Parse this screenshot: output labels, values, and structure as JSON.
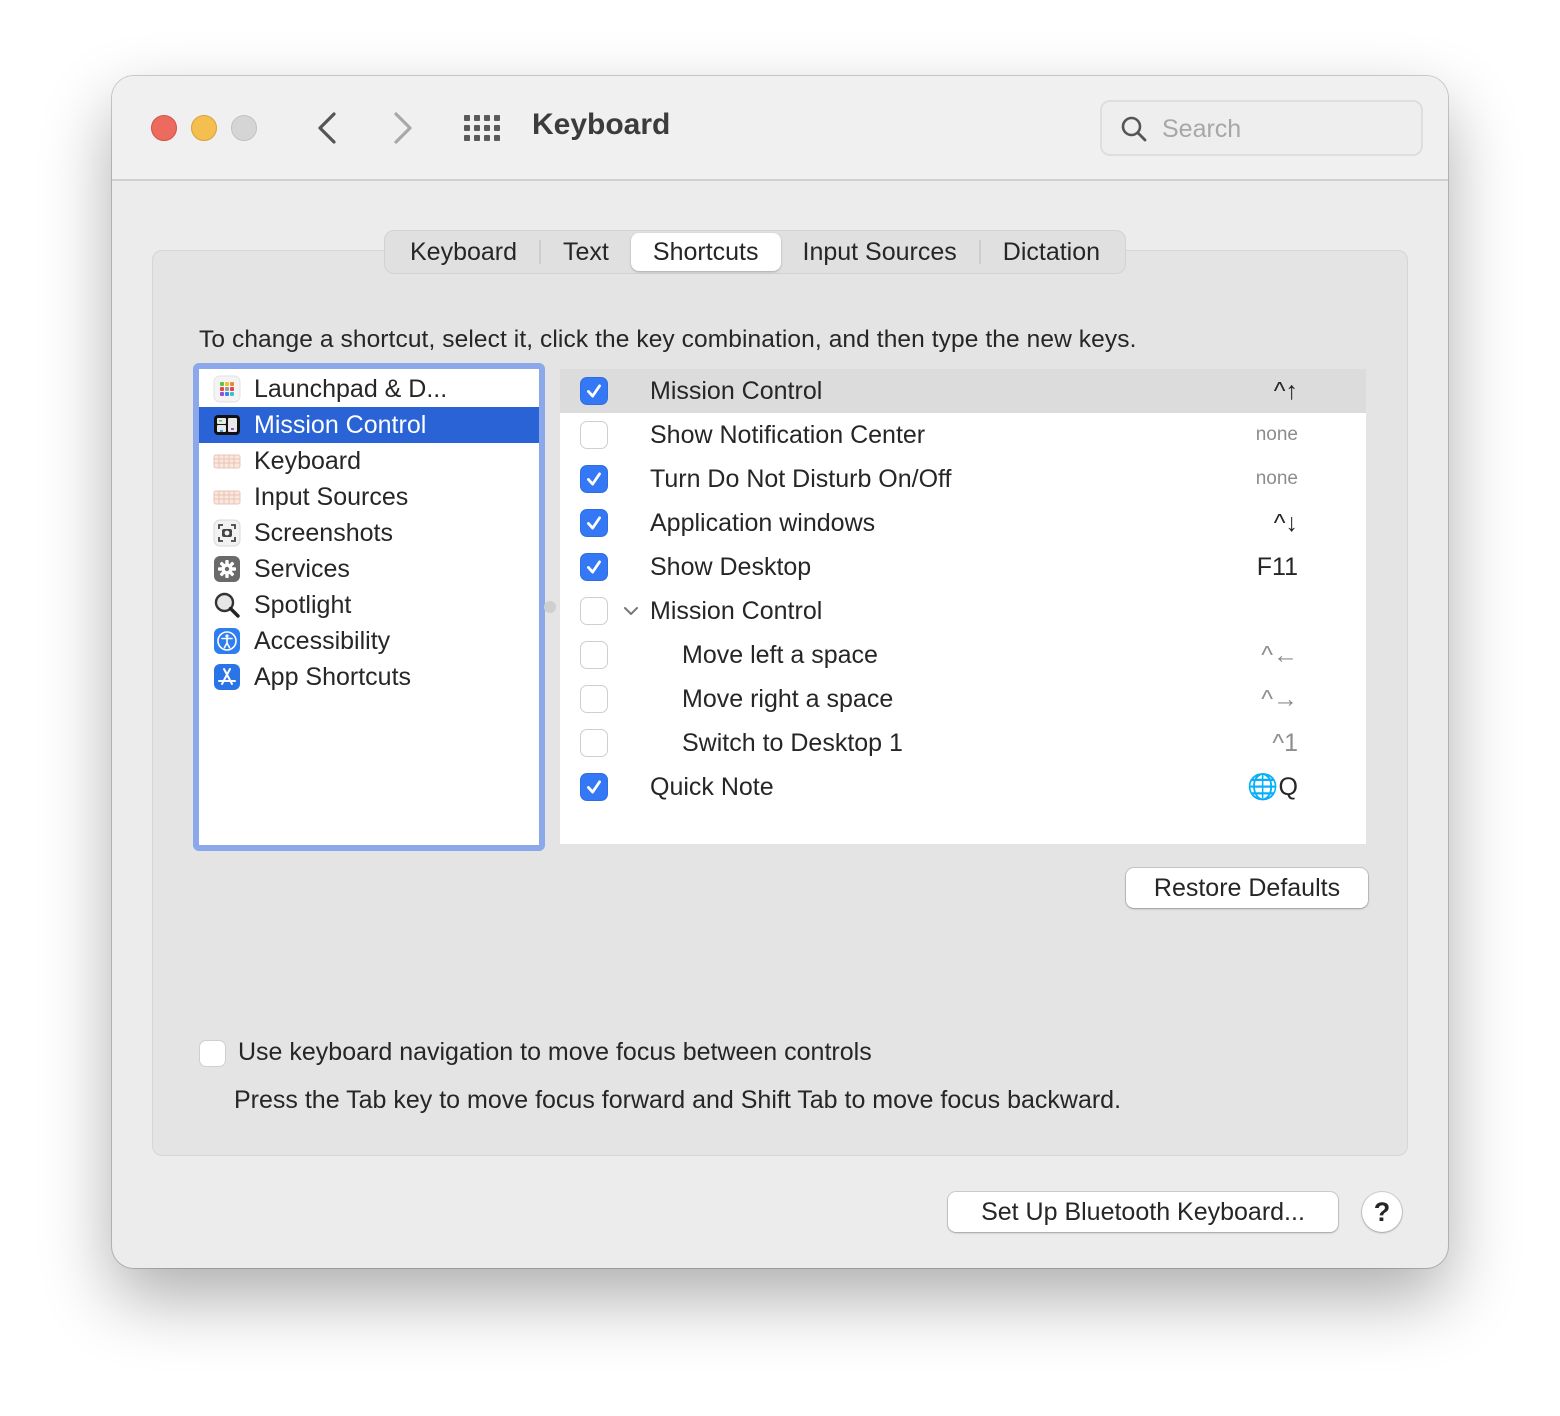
{
  "window": {
    "title": "Keyboard",
    "traffic_lights": {
      "close": "#ec6a5e",
      "minimize": "#f5bf4f",
      "zoom": "#d5d5d5"
    }
  },
  "toolbar": {
    "back_icon": "chevron-left-icon",
    "forward_icon": "chevron-right-icon",
    "show_all_icon": "grid-icon",
    "search": {
      "placeholder": "Search",
      "value": "",
      "icon": "magnifier-icon"
    }
  },
  "tabs": [
    {
      "label": "Keyboard",
      "active": false
    },
    {
      "label": "Text",
      "active": false
    },
    {
      "label": "Shortcuts",
      "active": true
    },
    {
      "label": "Input Sources",
      "active": false
    },
    {
      "label": "Dictation",
      "active": false
    }
  ],
  "instructions": "To change a shortcut, select it, click the key combination, and then type the new keys.",
  "categories": [
    {
      "label": "Launchpad & D...",
      "icon": "launchpad-icon",
      "selected": false
    },
    {
      "label": "Mission Control",
      "icon": "mission-control-icon",
      "selected": true
    },
    {
      "label": "Keyboard",
      "icon": "keyboard-icon",
      "selected": false
    },
    {
      "label": "Input Sources",
      "icon": "keyboard-icon",
      "selected": false
    },
    {
      "label": "Screenshots",
      "icon": "screenshot-icon",
      "selected": false
    },
    {
      "label": "Services",
      "icon": "gear-icon",
      "selected": false
    },
    {
      "label": "Spotlight",
      "icon": "magnifying-glass-icon",
      "selected": false
    },
    {
      "label": "Accessibility",
      "icon": "accessibility-icon",
      "selected": false
    },
    {
      "label": "App Shortcuts",
      "icon": "app-store-icon",
      "selected": false
    }
  ],
  "shortcuts": [
    {
      "label": "Mission Control",
      "checked": true,
      "key": "^↑",
      "selected": true,
      "indent": false,
      "style": "normal"
    },
    {
      "label": "Show Notification Center",
      "checked": false,
      "key": "none",
      "selected": false,
      "indent": false,
      "style": "muted"
    },
    {
      "label": "Turn Do Not Disturb On/Off",
      "checked": true,
      "key": "none",
      "selected": false,
      "indent": false,
      "style": "muted"
    },
    {
      "label": "Application windows",
      "checked": true,
      "key": "^↓",
      "selected": false,
      "indent": false,
      "style": "normal"
    },
    {
      "label": "Show Desktop",
      "checked": true,
      "key": "F11",
      "selected": false,
      "indent": false,
      "style": "normal"
    },
    {
      "label": "Mission Control",
      "checked": false,
      "key": "",
      "selected": false,
      "indent": false,
      "style": "normal",
      "expandable": true,
      "expanded": true
    },
    {
      "label": "Move left a space",
      "checked": false,
      "key": "^←",
      "selected": false,
      "indent": true,
      "style": "dim"
    },
    {
      "label": "Move right a space",
      "checked": false,
      "key": "^→",
      "selected": false,
      "indent": true,
      "style": "dim"
    },
    {
      "label": "Switch to Desktop 1",
      "checked": false,
      "key": "^1",
      "selected": false,
      "indent": true,
      "style": "dim"
    },
    {
      "label": "Quick Note",
      "checked": true,
      "key": "🌐Q",
      "selected": false,
      "indent": false,
      "style": "normal"
    }
  ],
  "buttons": {
    "restore_defaults": "Restore Defaults",
    "bluetooth_keyboard": "Set Up Bluetooth Keyboard...",
    "help": "?"
  },
  "keyboard_navigation": {
    "label": "Use keyboard navigation to move focus between controls",
    "checked": false,
    "hint": "Press the Tab key to move focus forward and Shift Tab to move focus backward."
  },
  "colors": {
    "accent": "#2a63d6",
    "checkbox_checked": "#3478f6",
    "list_focus_ring": "#8ba8ea"
  }
}
